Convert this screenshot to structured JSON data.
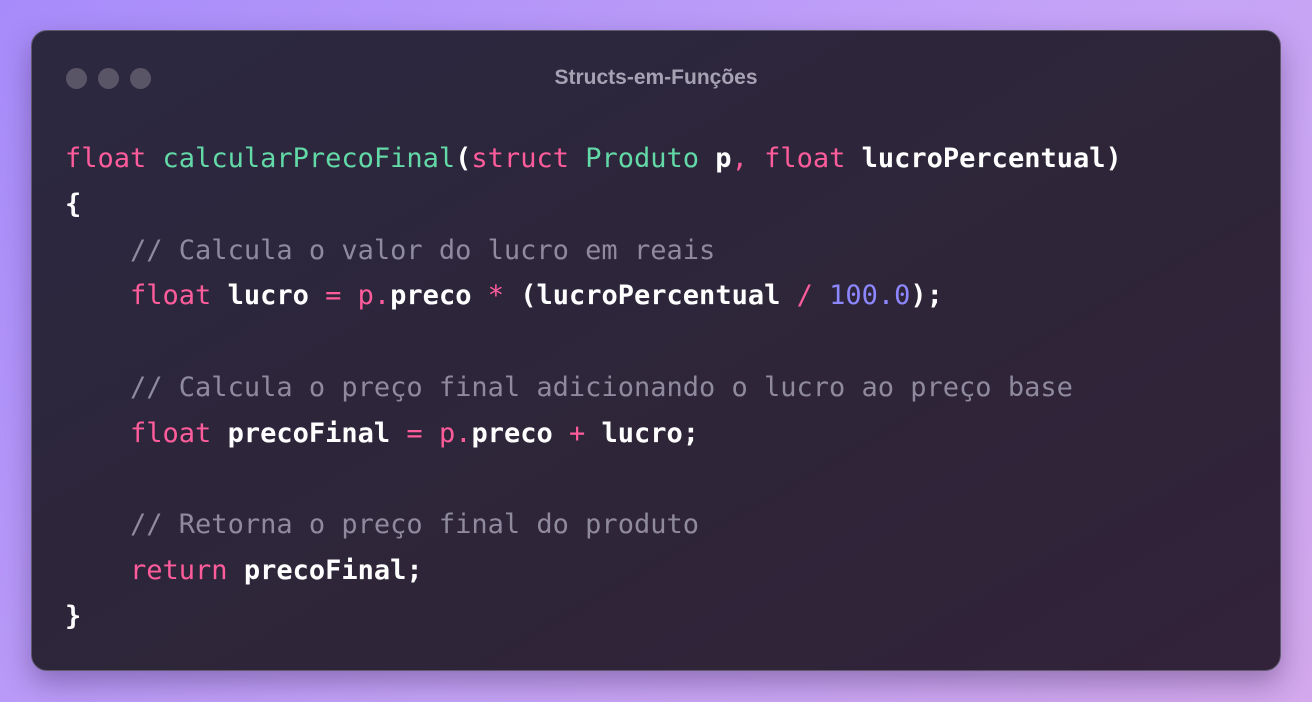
{
  "window": {
    "title": "Structs-em-Funções",
    "controls": [
      "close-dot",
      "minimize-dot",
      "zoom-dot"
    ]
  },
  "colors": {
    "keyword": "#ff5c9b",
    "function": "#62d9a6",
    "number": "#8c87ff",
    "comment": "#8f8a9d",
    "text": "#ffffff",
    "window_bg": "#2b2840",
    "page_bg": "#b497f8"
  },
  "code": {
    "lines": [
      [
        {
          "t": "float",
          "k": "keyword"
        },
        {
          "t": " ",
          "k": "ws"
        },
        {
          "t": "calcularPrecoFinal",
          "k": "function"
        },
        {
          "t": "(",
          "k": "punct"
        },
        {
          "t": "struct",
          "k": "keyword"
        },
        {
          "t": " ",
          "k": "ws"
        },
        {
          "t": "Produto",
          "k": "type"
        },
        {
          "t": " ",
          "k": "ws"
        },
        {
          "t": "p",
          "k": "ident"
        },
        {
          "t": ",",
          "k": "operator"
        },
        {
          "t": " ",
          "k": "ws"
        },
        {
          "t": "float",
          "k": "keyword"
        },
        {
          "t": " ",
          "k": "ws"
        },
        {
          "t": "lucroPercentual",
          "k": "ident"
        },
        {
          "t": ")",
          "k": "punct"
        }
      ],
      [
        {
          "t": "{",
          "k": "punct"
        }
      ],
      [
        {
          "t": "    ",
          "k": "ws"
        },
        {
          "t": "// Calcula o valor do lucro em reais",
          "k": "comment"
        }
      ],
      [
        {
          "t": "    ",
          "k": "ws"
        },
        {
          "t": "float",
          "k": "keyword"
        },
        {
          "t": " ",
          "k": "ws"
        },
        {
          "t": "lucro",
          "k": "ident"
        },
        {
          "t": " ",
          "k": "ws"
        },
        {
          "t": "=",
          "k": "operator"
        },
        {
          "t": " ",
          "k": "ws"
        },
        {
          "t": "p.",
          "k": "operator"
        },
        {
          "t": "preco",
          "k": "ident"
        },
        {
          "t": " ",
          "k": "ws"
        },
        {
          "t": "*",
          "k": "operator"
        },
        {
          "t": " ",
          "k": "ws"
        },
        {
          "t": "(lucroPercentual",
          "k": "ident"
        },
        {
          "t": " ",
          "k": "ws"
        },
        {
          "t": "/",
          "k": "operator"
        },
        {
          "t": " ",
          "k": "ws"
        },
        {
          "t": "100.0",
          "k": "number"
        },
        {
          "t": ");",
          "k": "punct"
        }
      ],
      [],
      [
        {
          "t": "    ",
          "k": "ws"
        },
        {
          "t": "// Calcula o preço final adicionando o lucro ao preço base",
          "k": "comment"
        }
      ],
      [
        {
          "t": "    ",
          "k": "ws"
        },
        {
          "t": "float",
          "k": "keyword"
        },
        {
          "t": " ",
          "k": "ws"
        },
        {
          "t": "precoFinal",
          "k": "ident"
        },
        {
          "t": " ",
          "k": "ws"
        },
        {
          "t": "=",
          "k": "operator"
        },
        {
          "t": " ",
          "k": "ws"
        },
        {
          "t": "p.",
          "k": "operator"
        },
        {
          "t": "preco",
          "k": "ident"
        },
        {
          "t": " ",
          "k": "ws"
        },
        {
          "t": "+",
          "k": "operator"
        },
        {
          "t": " ",
          "k": "ws"
        },
        {
          "t": "lucro;",
          "k": "ident"
        }
      ],
      [],
      [
        {
          "t": "    ",
          "k": "ws"
        },
        {
          "t": "// Retorna o preço final do produto",
          "k": "comment"
        }
      ],
      [
        {
          "t": "    ",
          "k": "ws"
        },
        {
          "t": "return",
          "k": "keyword"
        },
        {
          "t": " ",
          "k": "ws"
        },
        {
          "t": "precoFinal;",
          "k": "ident"
        }
      ],
      [
        {
          "t": "}",
          "k": "punct"
        }
      ]
    ]
  }
}
